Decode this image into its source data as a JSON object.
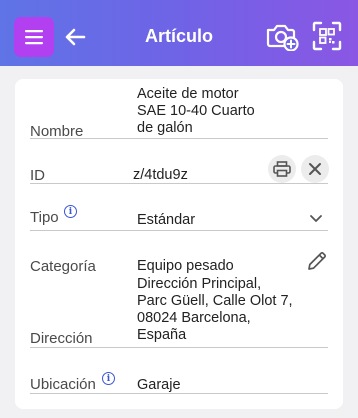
{
  "header": {
    "title": "Artículo",
    "icons": [
      "menu-icon",
      "back-arrow-icon",
      "camera-add-icon",
      "qr-scan-icon"
    ],
    "colors": {
      "bar_start": "#5f74e6",
      "bar_end": "#8a57e4",
      "menu_button": "#b23ff0"
    }
  },
  "fields": {
    "nombre": {
      "label": "Nombre",
      "value_lines": [
        "Aceite de motor",
        "SAE 10-40 Cuarto",
        "de galón"
      ]
    },
    "id": {
      "label": "ID",
      "value": "z/4tdu9z"
    },
    "tipo": {
      "label": "Tipo",
      "value": "Estándar"
    },
    "categoria": {
      "label": "Categoría",
      "value": "Equipo pesado"
    },
    "direccion": {
      "label": "Dirección",
      "value_lines": [
        "Dirección Principal,",
        "Parc Güell, Calle Olot 7,",
        "08024 Barcelona,",
        "España"
      ]
    },
    "ubicacion": {
      "label": "Ubicación",
      "value": "Garaje"
    }
  },
  "accent_color": "#3a55d6"
}
